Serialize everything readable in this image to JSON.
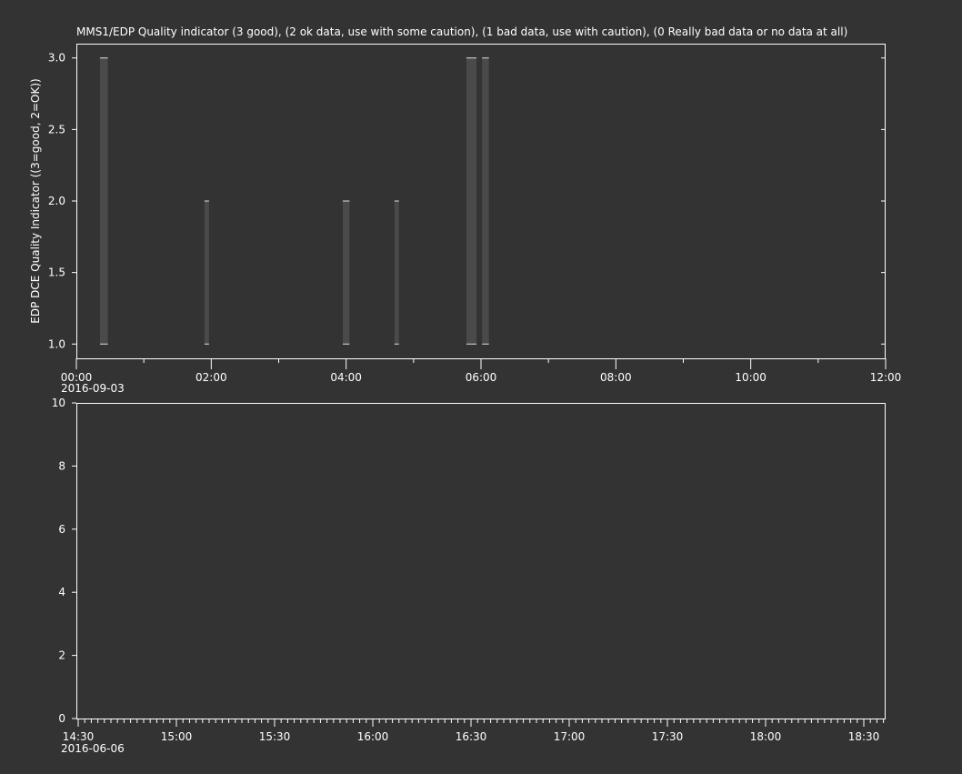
{
  "chart_data": [
    {
      "type": "bar",
      "title": "MMS1/EDP  Quality indicator (3 good), (2 ok data, use with some caution), (1 bad data, use with caution), (0 Really bad data or no data at all)",
      "ylabel": "EDP DCE Quality Indicator ((3=good, 2=OK))",
      "xlabel": "",
      "xlim": [
        0,
        720
      ],
      "ylim": [
        0.9,
        3.1
      ],
      "x_units": "minutes after 00:00",
      "x_tick_labels": [
        "00:00",
        "02:00",
        "04:00",
        "06:00",
        "08:00",
        "10:00",
        "12:00"
      ],
      "x_date_label": "2016-09-03",
      "y_tick_labels": [
        "1.0",
        "1.5",
        "2.0",
        "2.5",
        "3.0"
      ],
      "grid": false,
      "bars": [
        {
          "start": "00:21",
          "end": "00:28",
          "low": 1.0,
          "high": 3.0
        },
        {
          "start": "01:54",
          "end": "01:58",
          "low": 1.0,
          "high": 2.0
        },
        {
          "start": "03:57",
          "end": "04:03",
          "low": 1.0,
          "high": 2.0
        },
        {
          "start": "04:43",
          "end": "04:47",
          "low": 1.0,
          "high": 2.0
        },
        {
          "start": "05:47",
          "end": "05:56",
          "low": 1.0,
          "high": 3.0
        },
        {
          "start": "06:01",
          "end": "06:07",
          "low": 1.0,
          "high": 3.0
        }
      ]
    },
    {
      "type": "line",
      "title": "",
      "ylabel": "",
      "xlabel": "",
      "ylim": [
        0,
        10
      ],
      "x_tick_labels": [
        "14:30",
        "15:00",
        "15:30",
        "16:00",
        "16:30",
        "17:00",
        "17:30",
        "18:00",
        "18:30"
      ],
      "x_date_label": "2016-06-06",
      "y_tick_labels": [
        "0",
        "2",
        "4",
        "6",
        "8",
        "10"
      ],
      "series": []
    }
  ],
  "colors": {
    "background": "#333333",
    "axes": "#ffffff",
    "bar": "#4a4a4a"
  }
}
